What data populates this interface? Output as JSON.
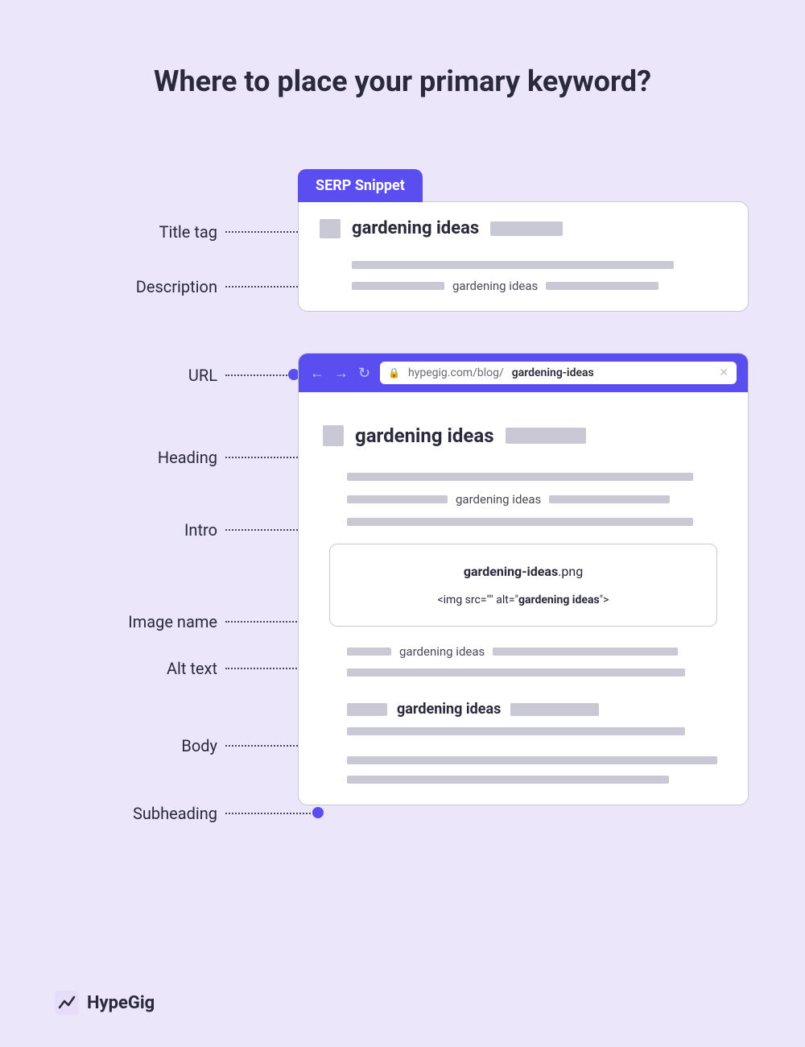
{
  "title": "Where to place your primary keyword?",
  "serp_tab": "SERP Snippet",
  "keyword": "gardening ideas",
  "keyword_slug": "gardening-ideas",
  "labels": {
    "title_tag": "Title tag",
    "description": "Description",
    "url": "URL",
    "heading": "Heading",
    "intro": "Intro",
    "image_name": "Image name",
    "alt_text": "Alt text",
    "body": "Body",
    "subheading": "Subheading"
  },
  "url_host": "hypegig.com/blog/",
  "image_ext": ".png",
  "alt_code_pre": "<img src=\"\" alt=\"",
  "alt_code_post": "\">",
  "brand": "HypeGig"
}
